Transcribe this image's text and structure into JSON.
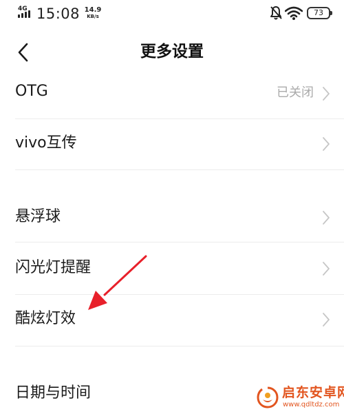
{
  "status_bar": {
    "network_type": "4G",
    "time": "15:08",
    "speed_value": "14.9",
    "speed_unit": "KB/s",
    "battery_level": "73",
    "icons": [
      "silent-bell-icon",
      "wifi-icon",
      "battery-icon"
    ]
  },
  "header": {
    "title": "更多设置",
    "back_icon": "back-arrow-icon"
  },
  "settings": {
    "items": [
      {
        "label": "OTG",
        "value": "已关闭"
      },
      {
        "label": "vivo互传"
      },
      {
        "label": "悬浮球"
      },
      {
        "label": "闪光灯提醒"
      },
      {
        "label": "酷炫灯效"
      },
      {
        "label": "日期与时间"
      }
    ],
    "chevron_icon": "chevron-right-icon"
  },
  "watermark": {
    "name": "启东安卓网",
    "url": "www.qdltdz.com"
  },
  "colors": {
    "arrow": "#e8202a",
    "watermark": "#e2551f",
    "value_text": "#aaaaaa",
    "chevron": "#c6c6c6"
  }
}
